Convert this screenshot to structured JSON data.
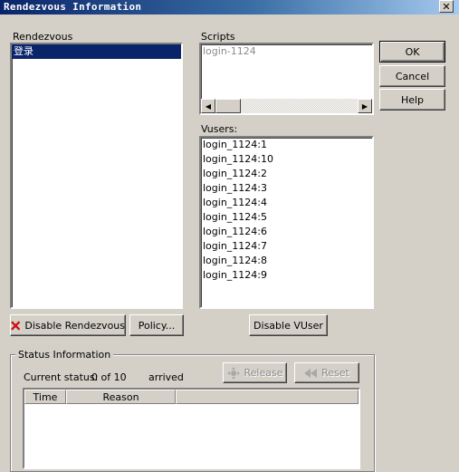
{
  "window": {
    "title": "Rendezvous Information",
    "close_glyph": "✕"
  },
  "rendezvous": {
    "label": "Rendezvous",
    "items": [
      "登录"
    ]
  },
  "scripts": {
    "label": "Scripts",
    "items": [
      "login-1124"
    ]
  },
  "vusers": {
    "label": "Vusers:",
    "items": [
      "login_1124:1",
      "login_1124:10",
      "login_1124:2",
      "login_1124:3",
      "login_1124:4",
      "login_1124:5",
      "login_1124:6",
      "login_1124:7",
      "login_1124:8",
      "login_1124:9"
    ]
  },
  "buttons": {
    "ok": "OK",
    "cancel": "Cancel",
    "help": "Help",
    "disable_rendezvous": "Disable Rendezvous",
    "policy": "Policy...",
    "disable_vuser": "Disable VUser",
    "release": "Release",
    "reset": "Reset"
  },
  "status": {
    "group_label": "Status Information",
    "current_status_label": "Current status:",
    "count": "0 of 10",
    "arrived": "arrived",
    "columns": [
      "Time",
      "Reason"
    ]
  },
  "icons": {
    "disable": "red-x-icon",
    "release": "release-icon",
    "reset": "rewind-icon"
  },
  "colors": {
    "titlebar_start": "#0a246a",
    "titlebar_end": "#a6caf0",
    "selection": "#0a246a",
    "face": "#d4d0c8",
    "disable_icon": "#cc1111"
  }
}
